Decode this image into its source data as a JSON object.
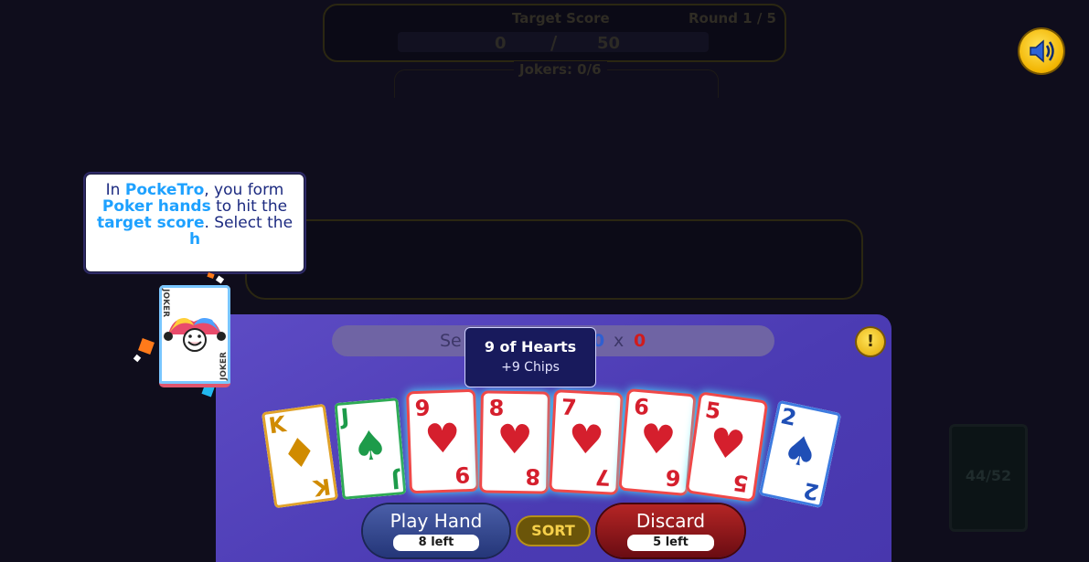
{
  "header": {
    "target_label": "Target Score",
    "round_label": "Round 1 / 5",
    "score_current": "0",
    "score_slash": "/",
    "score_goal": "50",
    "jokers_label": "Jokers: 0/6"
  },
  "tutorial": {
    "part1": "In ",
    "brand": "PockeTro",
    "part2": ", you form ",
    "hl1": "Poker hands",
    "part3": " to hit the ",
    "hl2": "target score",
    "part4": ". Select the ",
    "hl3": "h"
  },
  "joker": {
    "label": "JOKER"
  },
  "select_bar": {
    "text": "Se",
    "chips": "0",
    "x": "x",
    "mult": "0",
    "info": "!"
  },
  "tooltip": {
    "title": "9 of Hearts",
    "subtitle": "+9 Chips"
  },
  "cards": [
    {
      "rank": "K",
      "suit": "♦",
      "face": "king"
    },
    {
      "rank": "J",
      "suit": "♠",
      "face": "jack"
    },
    {
      "rank": "9",
      "suit": "♥",
      "selected": true
    },
    {
      "rank": "8",
      "suit": "♥",
      "selected": true
    },
    {
      "rank": "7",
      "suit": "♥",
      "selected": true
    },
    {
      "rank": "6",
      "suit": "♥",
      "selected": true
    },
    {
      "rank": "5",
      "suit": "♥",
      "selected": true
    },
    {
      "rank": "2",
      "suit": "♠"
    }
  ],
  "buttons": {
    "play_label": "Play Hand",
    "play_sub": "8 left",
    "sort_label": "SORT",
    "discard_label": "Discard",
    "discard_sub": "5 left"
  },
  "deck": {
    "count": "44/52"
  },
  "colors": {
    "table": "#4b3bb3",
    "accent_blue": "#1ea1ff",
    "heart_red": "#d51f2d",
    "gold": "#f2b400"
  }
}
